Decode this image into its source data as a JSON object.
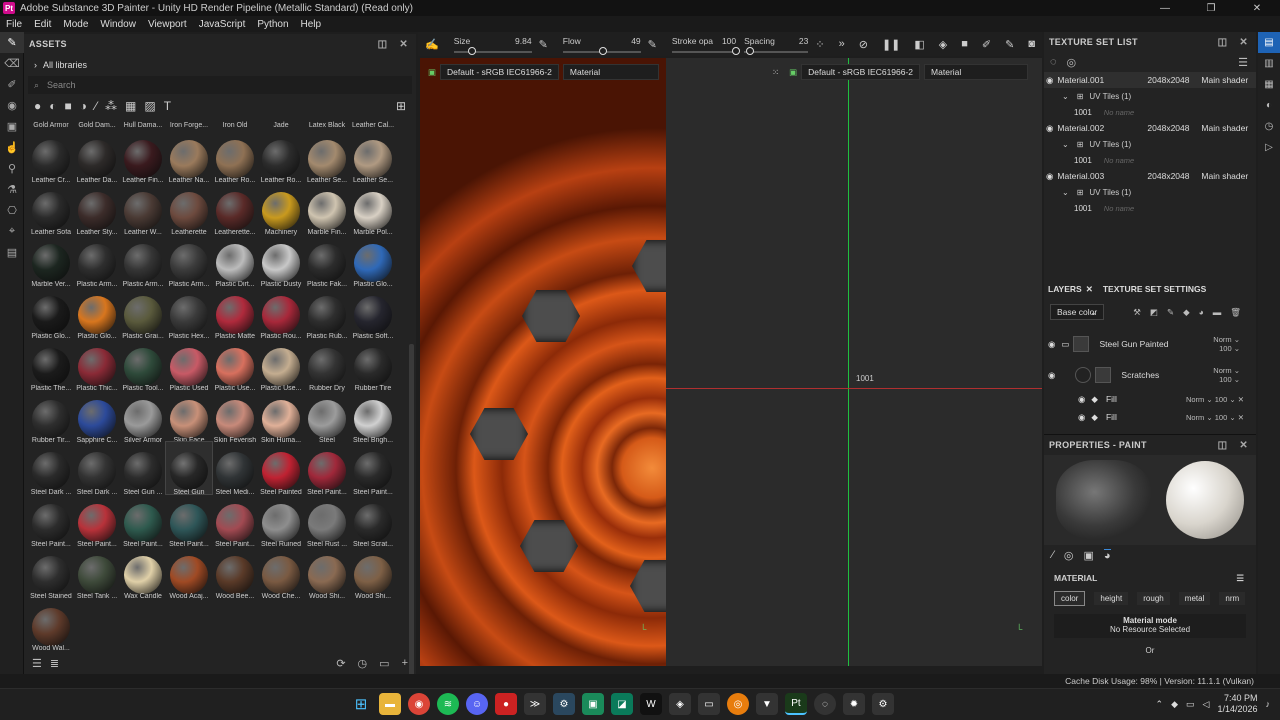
{
  "window": {
    "title": "Adobe Substance 3D Painter - Unity HD Render Pipeline (Metallic Standard) (Read only)",
    "app_icon": "Pt",
    "controls": [
      "—",
      "❐",
      "✕"
    ]
  },
  "menu": [
    "File",
    "Edit",
    "Mode",
    "Window",
    "Viewport",
    "JavaScript",
    "Python",
    "Help"
  ],
  "assets": {
    "title": "ASSETS",
    "library": "All libraries",
    "search_placeholder": "Search",
    "top_row": [
      "Gold Armor",
      "Gold Dam...",
      "Hull Dama...",
      "Iron Forge...",
      "Iron Old",
      "Jade",
      "Latex Black",
      "Leather Cal..."
    ],
    "materials": [
      {
        "name": "Leather Cr...",
        "color": "#2b2b2b"
      },
      {
        "name": "Leather Da...",
        "color": "#2d2a29"
      },
      {
        "name": "Leather Fin...",
        "color": "#3a1a1e"
      },
      {
        "name": "Leather Na...",
        "color": "#9a7a5c"
      },
      {
        "name": "Leather Ro...",
        "color": "#8f7154"
      },
      {
        "name": "Leather Ro...",
        "color": "#2c2c2c"
      },
      {
        "name": "Leather Se...",
        "color": "#a38a6e"
      },
      {
        "name": "Leather Se...",
        "color": "#b09a82"
      },
      {
        "name": "Leather Sofa",
        "color": "#2a2a2a"
      },
      {
        "name": "Leather Sty...",
        "color": "#3c2c2a"
      },
      {
        "name": "Leather W...",
        "color": "#4a3a34"
      },
      {
        "name": "Leatherette",
        "color": "#6d4a3e"
      },
      {
        "name": "Leatherette...",
        "color": "#5a2a28"
      },
      {
        "name": "Machinery",
        "color": "#c99a1e"
      },
      {
        "name": "Marble Fin...",
        "color": "#cfc4b0"
      },
      {
        "name": "Marble Pol...",
        "color": "#d8d0c4"
      },
      {
        "name": "Marble Ver...",
        "color": "#1c2620"
      },
      {
        "name": "Plastic Arm...",
        "color": "#2e2e2e"
      },
      {
        "name": "Plastic Arm...",
        "color": "#353535"
      },
      {
        "name": "Plastic Arm...",
        "color": "#3b3b3b"
      },
      {
        "name": "Plastic Dirt...",
        "color": "#bcbcbc"
      },
      {
        "name": "Plastic Dusty",
        "color": "#c8c8c8"
      },
      {
        "name": "Plastic Fak...",
        "color": "#2c2c2c"
      },
      {
        "name": "Plastic Glo...",
        "color": "#2f69b8"
      },
      {
        "name": "Plastic Glo...",
        "color": "#1a1a1a"
      },
      {
        "name": "Plastic Glo...",
        "color": "#d8761e"
      },
      {
        "name": "Plastic Grai...",
        "color": "#5a5a3c"
      },
      {
        "name": "Plastic Hex...",
        "color": "#3a3a3a"
      },
      {
        "name": "Plastic Matte",
        "color": "#b02a3c"
      },
      {
        "name": "Plastic Rou...",
        "color": "#a8283a"
      },
      {
        "name": "Plastic Rub...",
        "color": "#2e2e2e"
      },
      {
        "name": "Plastic Soft...",
        "color": "#25252e"
      },
      {
        "name": "Plastic The...",
        "color": "#1b1b1b"
      },
      {
        "name": "Plastic Thic...",
        "color": "#8a2a36"
      },
      {
        "name": "Plastic Tool...",
        "color": "#2e4a3a"
      },
      {
        "name": "Plastic Used",
        "color": "#c85a66"
      },
      {
        "name": "Plastic Use...",
        "color": "#d8705e"
      },
      {
        "name": "Plastic Use...",
        "color": "#c4ad90"
      },
      {
        "name": "Rubber Dry",
        "color": "#333333"
      },
      {
        "name": "Rubber Tire",
        "color": "#2a2a2a"
      },
      {
        "name": "Rubber Tir...",
        "color": "#2e2e2e"
      },
      {
        "name": "Sapphire C...",
        "color": "#2c4a9a"
      },
      {
        "name": "Silver Armor",
        "color": "#9a9a9a"
      },
      {
        "name": "Skin Face",
        "color": "#c89078"
      },
      {
        "name": "Skin Feverish",
        "color": "#c88a7a"
      },
      {
        "name": "Skin Huma...",
        "color": "#e0b098"
      },
      {
        "name": "Steel",
        "color": "#9c9c9c"
      },
      {
        "name": "Steel Brigh...",
        "color": "#d0d0d0"
      },
      {
        "name": "Steel Dark ...",
        "color": "#2a2a2a"
      },
      {
        "name": "Steel Dark ...",
        "color": "#333333"
      },
      {
        "name": "Steel Gun ...",
        "color": "#2c2c2c"
      },
      {
        "name": "Steel Gun",
        "color": "#272727",
        "selected": true
      },
      {
        "name": "Steel Medi...",
        "color": "#303436"
      },
      {
        "name": "Steel Painted",
        "color": "#c02232"
      },
      {
        "name": "Steel Paint...",
        "color": "#a0283a"
      },
      {
        "name": "Steel Paint...",
        "color": "#2a2a2a"
      },
      {
        "name": "Steel Paint...",
        "color": "#2c2c2c"
      },
      {
        "name": "Steel Paint...",
        "color": "#b8323a"
      },
      {
        "name": "Steel Paint...",
        "color": "#2e5a4e"
      },
      {
        "name": "Steel Paint...",
        "color": "#2e5658"
      },
      {
        "name": "Steel Paint...",
        "color": "#a24a52"
      },
      {
        "name": "Steel Ruined",
        "color": "#8e8e8e"
      },
      {
        "name": "Steel Rust ...",
        "color": "#7a7a7a"
      },
      {
        "name": "Steel Scrat...",
        "color": "#2a2a2a"
      },
      {
        "name": "Steel Stained",
        "color": "#2e2e2e"
      },
      {
        "name": "Steel Tank ...",
        "color": "#3e4a3a"
      },
      {
        "name": "Wax Candle",
        "color": "#e0d0a8"
      },
      {
        "name": "Wood Acaj...",
        "color": "#a04a24"
      },
      {
        "name": "Wood Bee...",
        "color": "#5a3a28"
      },
      {
        "name": "Wood Che...",
        "color": "#7a5a42"
      },
      {
        "name": "Wood Shi...",
        "color": "#8a6a52"
      },
      {
        "name": "Wood Shi...",
        "color": "#7e6046"
      },
      {
        "name": "Wood Wal...",
        "color": "#5e3a2a"
      }
    ]
  },
  "toolbar": {
    "size_label": "Size",
    "size_value": "9.84",
    "flow_label": "Flow",
    "flow_value": "49",
    "stroke_label": "Stroke opa",
    "stroke_value": "100",
    "spacing_label": "Spacing",
    "spacing_value": "23"
  },
  "viewport": {
    "left_colorspace": "Default - sRGB IEC61966-2",
    "left_mode": "Material",
    "right_colorspace": "Default - sRGB IEC61966-2",
    "right_mode": "Material",
    "uv_tile": "1001"
  },
  "texture_sets": {
    "title": "TEXTURE SET LIST",
    "items": [
      {
        "name": "Material.001",
        "size": "2048x2048",
        "shader": "Main shader",
        "uv": "UV Tiles (1)",
        "tile": "1001",
        "tile_name": "No name"
      },
      {
        "name": "Material.002",
        "size": "2048x2048",
        "shader": "Main shader",
        "uv": "UV Tiles (1)",
        "tile": "1001",
        "tile_name": "No name"
      },
      {
        "name": "Material.003",
        "size": "2048x2048",
        "shader": "Main shader",
        "uv": "UV Tiles (1)",
        "tile": "1001",
        "tile_name": "No name"
      }
    ]
  },
  "layers": {
    "tab_layers": "LAYERS",
    "tab_settings": "TEXTURE SET SETTINGS",
    "channel": "Base color",
    "rows": [
      {
        "name": "Steel Gun Painted",
        "blend": "Norm",
        "opacity": "100"
      },
      {
        "name": "Scratches",
        "blend": "Norm",
        "opacity": "100"
      },
      {
        "name": "Fill",
        "blend": "Norm",
        "opacity": "100"
      },
      {
        "name": "Fill",
        "blend": "Norm",
        "opacity": "100"
      }
    ]
  },
  "properties": {
    "title": "PROPERTIES - PAINT",
    "section": "MATERIAL",
    "channels": [
      "color",
      "height",
      "rough",
      "metal",
      "nrm"
    ],
    "mode_title": "Material mode",
    "mode_value": "No Resource Selected",
    "or": "Or"
  },
  "status": {
    "text": "Cache Disk Usage:  98% | Version: 11.1.1 (Vulkan)"
  },
  "taskbar": {
    "time": "7:40 PM",
    "date": "1/14/2026"
  }
}
